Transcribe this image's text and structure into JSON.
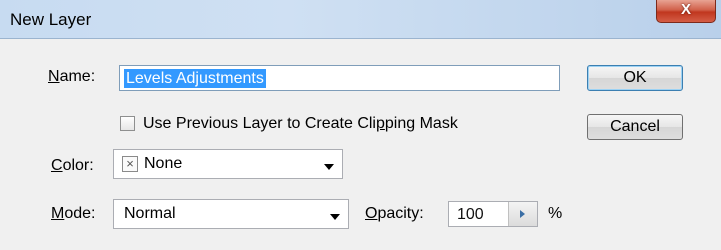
{
  "window": {
    "title": "New Layer",
    "close_glyph": "X"
  },
  "form": {
    "name_label_key": "N",
    "name_label_rest": "ame:",
    "name_value": "Levels Adjustments",
    "clipping_label_pre": "Use Previous Layer to Create Cli",
    "clipping_label_key": "p",
    "clipping_label_post": "ping Mask",
    "clipping_checked": false,
    "color_label_key": "C",
    "color_label_rest": "olor:",
    "color_value": "None",
    "color_icon": "x-none-icon",
    "mode_label_key": "M",
    "mode_label_rest": "ode:",
    "mode_value": "Normal",
    "opacity_label_key": "O",
    "opacity_label_rest": "pacity:",
    "opacity_value": "100",
    "opacity_unit": "%"
  },
  "buttons": {
    "ok": "OK",
    "cancel": "Cancel"
  }
}
